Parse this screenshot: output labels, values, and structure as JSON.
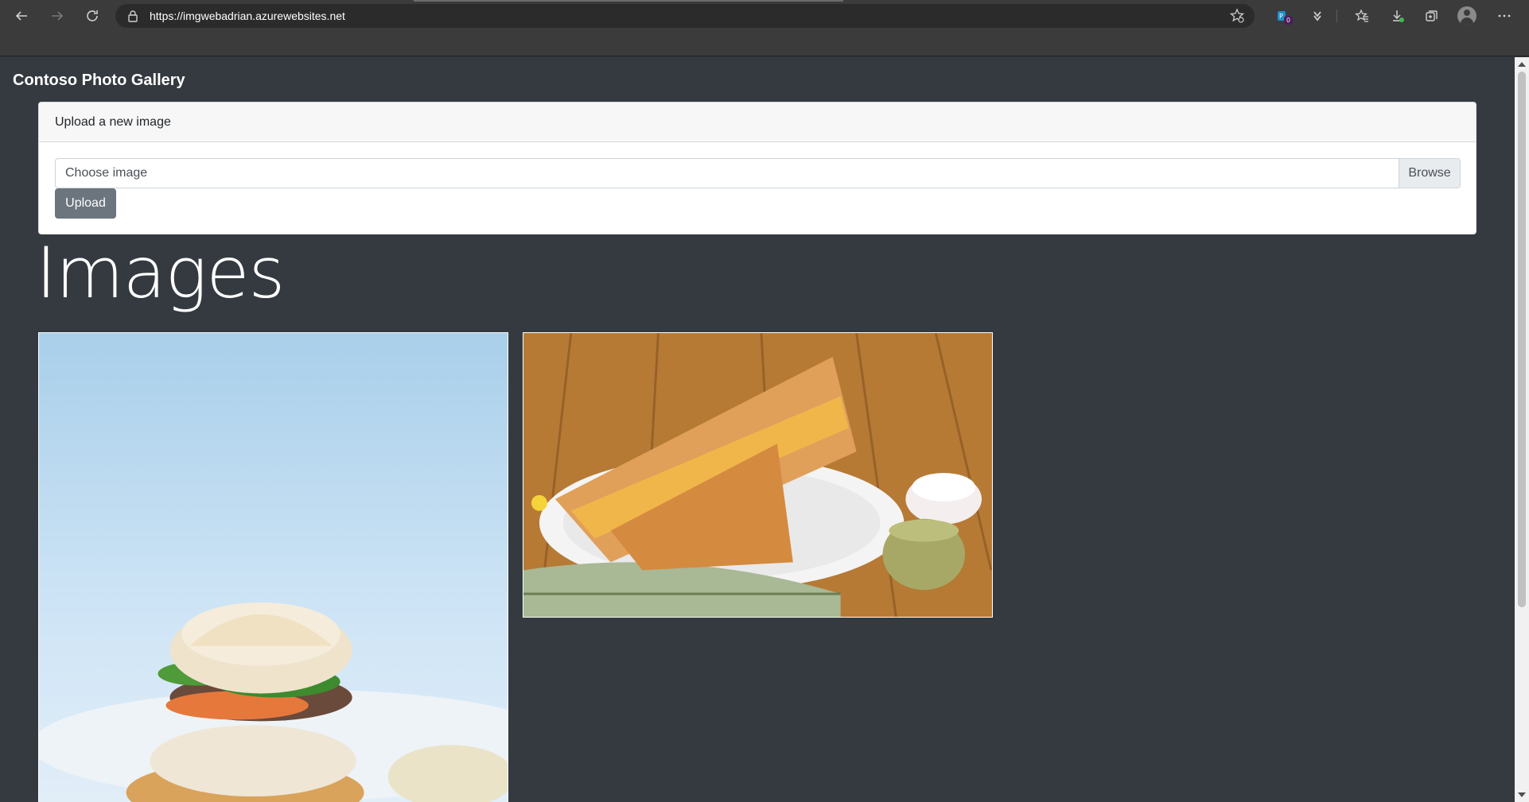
{
  "browser": {
    "url": "https://imgwebadrian.azurewebsites.net",
    "extension_badge_count": "0",
    "icons": [
      "back-icon",
      "forward-icon",
      "refresh-icon",
      "lock-icon",
      "add-favorite-icon",
      "extension-icon",
      "extension-icon-2",
      "favorites-icon",
      "downloads-icon",
      "collections-icon",
      "profile-icon",
      "more-icon"
    ]
  },
  "page": {
    "brand": "Contoso Photo Gallery",
    "upload_card": {
      "header": "Upload a new image",
      "file_placeholder": "Choose image",
      "browse_label": "Browse",
      "upload_label": "Upload"
    },
    "images_heading": "Images"
  },
  "colors": {
    "page_background": "#343a40",
    "chrome_background": "#3b3b3b",
    "upload_button": "#6c757d",
    "card_header": "#f7f7f7"
  }
}
